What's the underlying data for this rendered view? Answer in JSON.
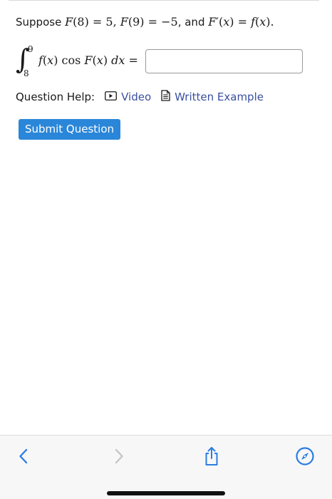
{
  "problem": {
    "prefix": "Suppose ",
    "and_word": ", and "
  },
  "integral": {
    "upper_limit": "9",
    "lower_limit": "8",
    "answer_value": ""
  },
  "question_help": {
    "label": "Question Help:",
    "video_label": "Video",
    "written_example_label": "Written Example"
  },
  "submit": {
    "label": "Submit Question"
  },
  "toolbar": {
    "back_icon": "chevron-left-icon",
    "forward_icon": "chevron-right-icon",
    "share_icon": "share-icon",
    "compass_icon": "compass-icon",
    "active_color": "#2a7de1",
    "disabled_color": "#c5c5c7"
  },
  "colors": {
    "link": "#3a4fa0",
    "button": "#2a86d9"
  }
}
